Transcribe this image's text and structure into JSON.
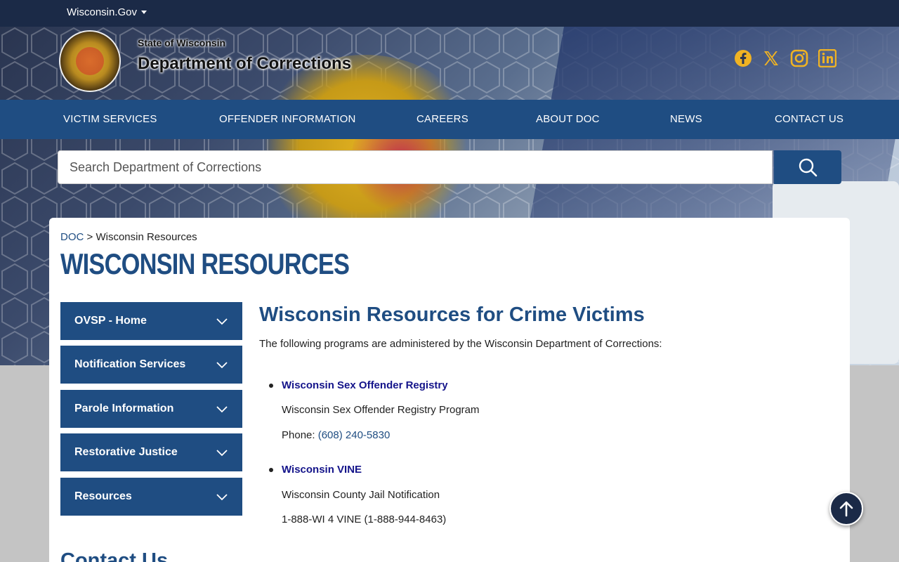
{
  "topbar": {
    "wisconsin_gov": "Wisconsin.Gov"
  },
  "header": {
    "state_name": "State of Wisconsin",
    "department_name": "Department of Corrections",
    "social_icons": [
      "facebook-icon",
      "x-icon",
      "instagram-icon",
      "linkedin-icon"
    ]
  },
  "nav": {
    "items": [
      {
        "label": "VICTIM SERVICES"
      },
      {
        "label": "OFFENDER INFORMATION"
      },
      {
        "label": "CAREERS"
      },
      {
        "label": "ABOUT DOC"
      },
      {
        "label": "NEWS"
      },
      {
        "label": "CONTACT US"
      }
    ]
  },
  "search": {
    "placeholder": "Search Department of Corrections",
    "icon": "search-icon"
  },
  "breadcrumb": {
    "root": "DOC",
    "separator": ">",
    "current": "Wisconsin Resources"
  },
  "page_title": "WISCONSIN RESOURCES",
  "sidebar": {
    "items": [
      {
        "label": "OVSP - Home"
      },
      {
        "label": "Notification Services"
      },
      {
        "label": "Parole Information"
      },
      {
        "label": "Restorative Justice"
      },
      {
        "label": "Resources"
      }
    ]
  },
  "content": {
    "heading": "Wisconsin Resources for Crime Victims",
    "intro": "The following programs are administered by the Wisconsin Department of Corrections:",
    "programs": [
      {
        "title": "Wisconsin Sex Offender Registry",
        "description": "Wisconsin Sex Offender Registry Program",
        "phone_label": "Phone:",
        "phone": "(608) 240-5830"
      },
      {
        "title": "Wisconsin VINE",
        "description": "Wisconsin County Jail Notification",
        "phone_text": "1-888-WI 4 VINE (1-888-944-8463)"
      }
    ],
    "contact_heading": "Contact Us"
  },
  "colors": {
    "topbar": "#1b2a47",
    "primary_blue": "#1f4d82",
    "social_yellow": "#f0b323",
    "link_navy": "#14148a"
  }
}
